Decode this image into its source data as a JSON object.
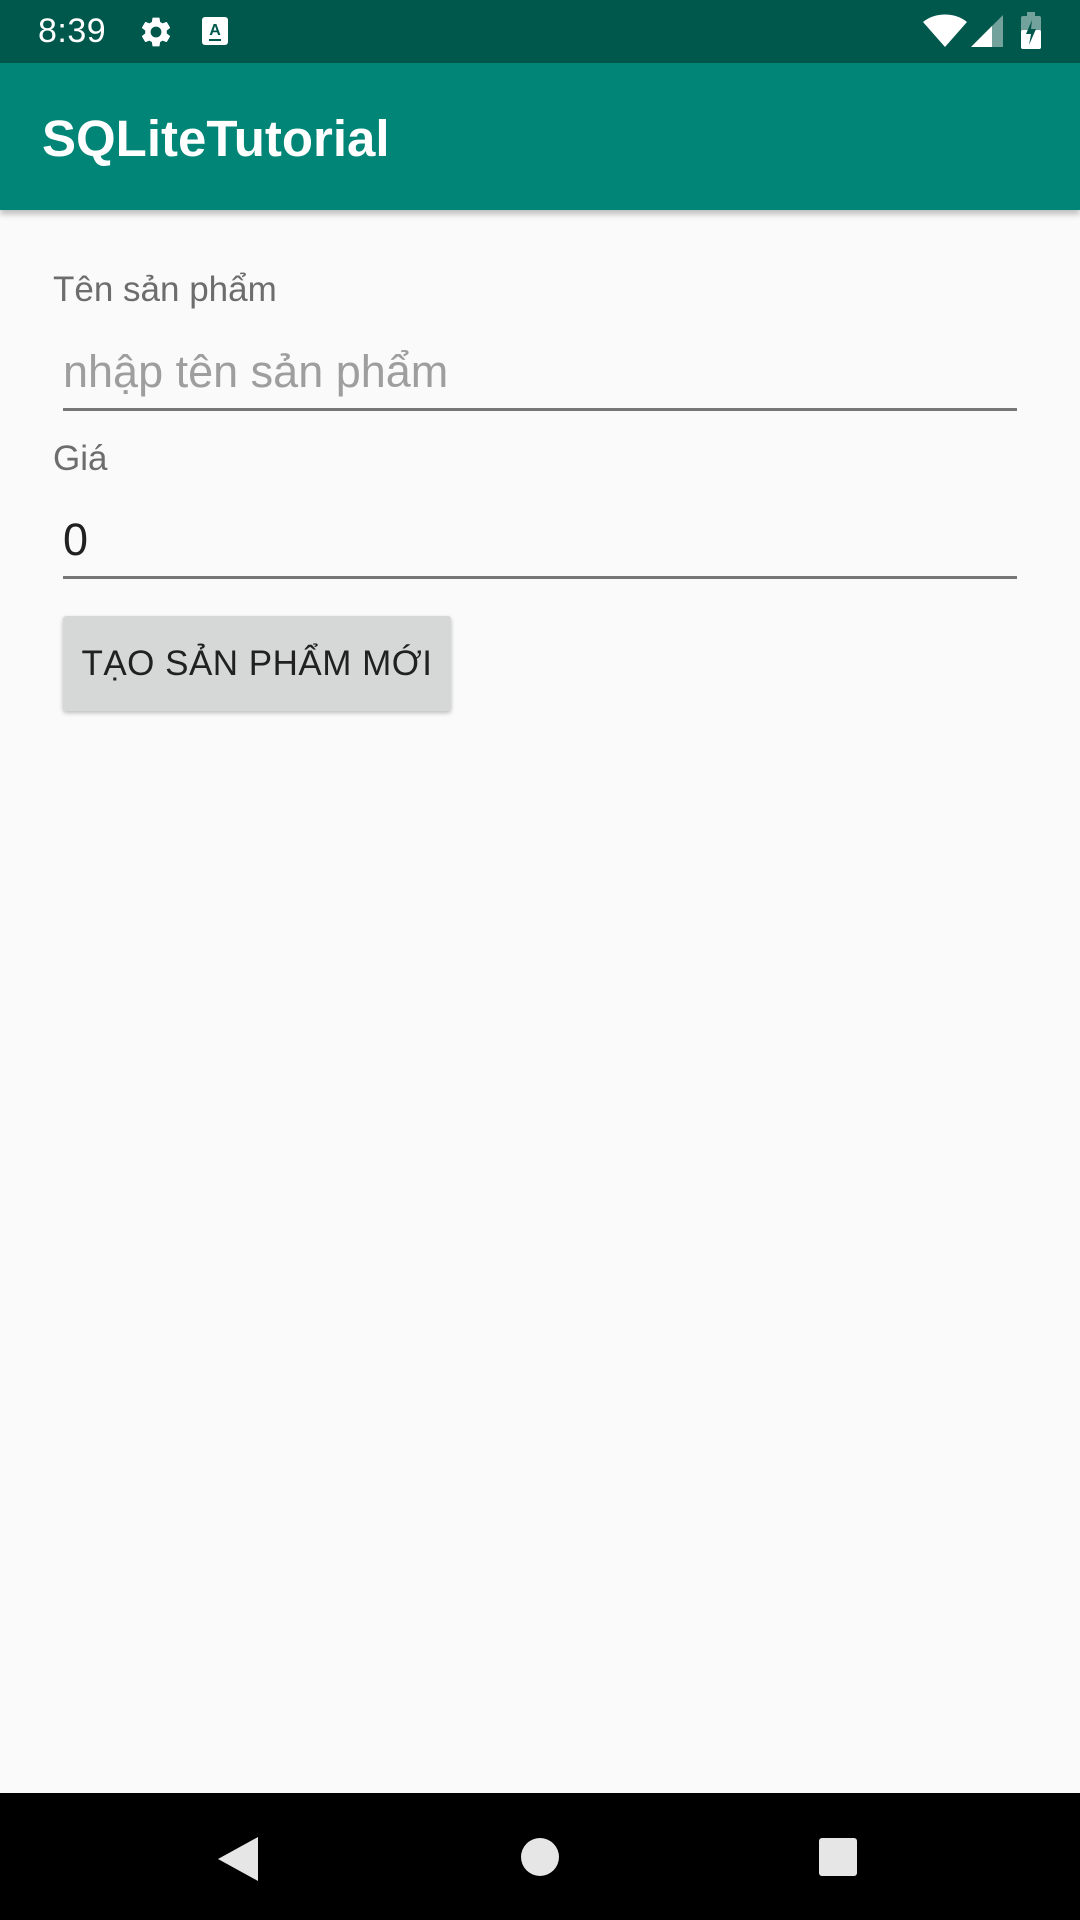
{
  "status_bar": {
    "time": "8:39",
    "icons": [
      "gear-icon",
      "keyboard-a-icon",
      "wifi-icon",
      "cell-signal-icon",
      "battery-charging-icon"
    ],
    "color": "#00574b"
  },
  "app_bar": {
    "title": "SQLiteTutorial",
    "color": "#008577"
  },
  "form": {
    "name_label": "Tên sản phẩm",
    "name_placeholder": "nhập tên sản phẩm",
    "name_value": "",
    "price_label": "Giá",
    "price_value": "0",
    "create_button_label": "TẠO SẢN PHẨM MỚI"
  },
  "nav_bar": {
    "icons": [
      "back-icon",
      "home-icon",
      "recents-icon"
    ]
  }
}
